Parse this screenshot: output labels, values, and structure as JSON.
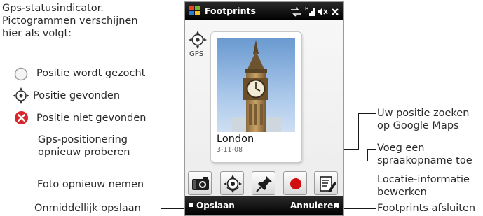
{
  "app": {
    "title": "Footprints",
    "gps_label": "GPS",
    "place_name": "London",
    "place_date": "3-11-08",
    "softkeys": {
      "left": "Opslaan",
      "right": "Annuleren"
    }
  },
  "callouts": {
    "gps_status": [
      "Gps-statusindicator.",
      "Pictogrammen verschijnen",
      "hier als volgt:"
    ],
    "legend": [
      {
        "icon": "empty-circle-icon",
        "label": "Positie wordt gezocht"
      },
      {
        "icon": "gps-crosshair-icon",
        "label": "Positie gevonden"
      },
      {
        "icon": "red-x-icon",
        "label": "Positie niet gevonden"
      }
    ],
    "retry_gps": [
      "Gps-positionering",
      "opnieuw proberen"
    ],
    "retake_photo": "Foto opnieuw nemen",
    "save_now": "Onmiddellijk opslaan",
    "find_google_maps": [
      "Uw positie zoeken",
      "op Google Maps"
    ],
    "add_voice": [
      "Voeg een",
      "spraakopname toe"
    ],
    "edit_location": [
      "Locatie-informatie",
      "bewerken"
    ],
    "close_footprints": "Footprints afsluiten"
  },
  "colors": {
    "titlebar": "#000000",
    "error_red": "#d9262b",
    "record_red": "#d10f10"
  }
}
